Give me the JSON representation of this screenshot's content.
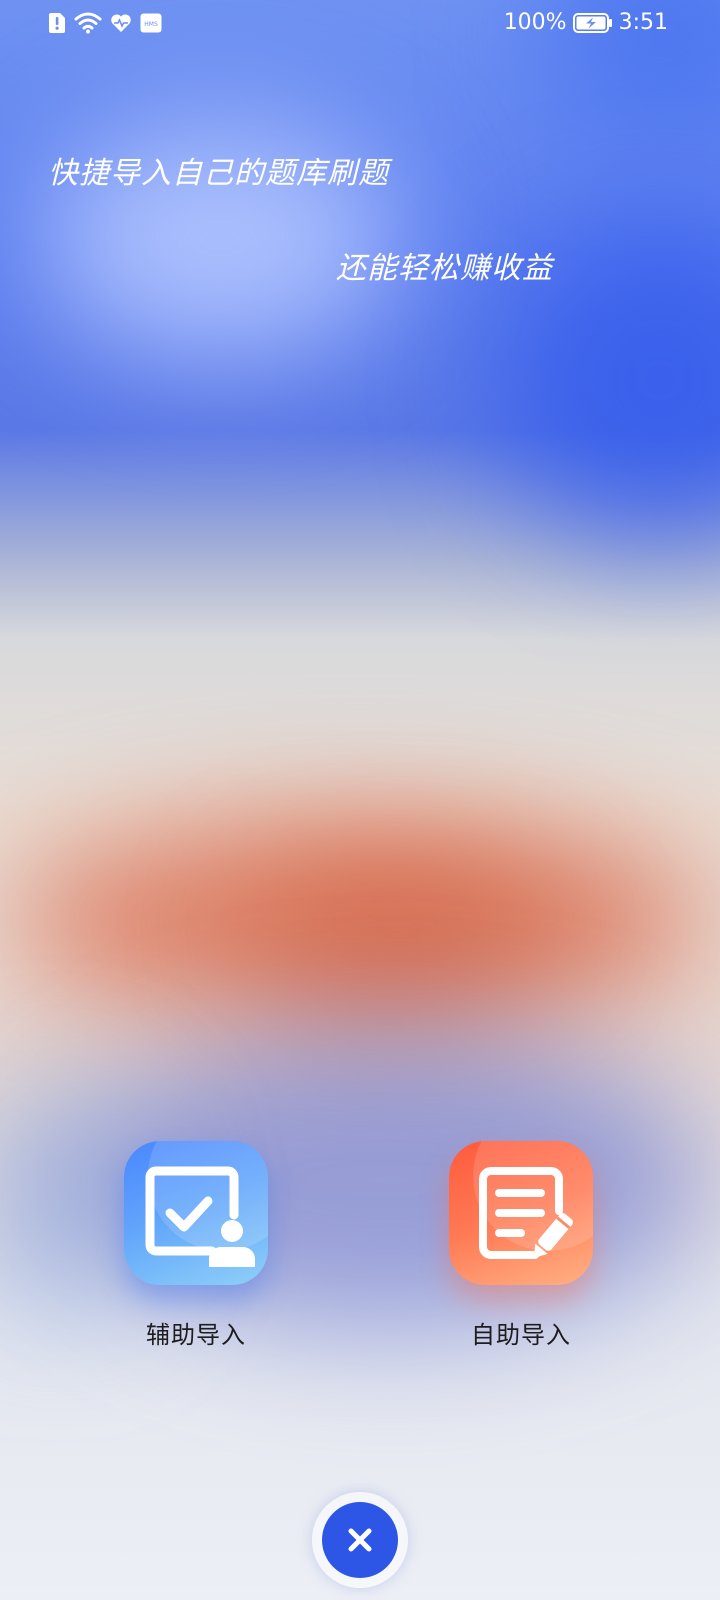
{
  "status_bar": {
    "battery_percent": "100%",
    "time": "3:51",
    "icons": [
      "alert-sim-icon",
      "wifi-icon",
      "heart-icon",
      "hms-icon",
      "battery-charging-icon"
    ],
    "hms_label": "HMS"
  },
  "slogan": {
    "line1": "快捷导入自己的题库刷题",
    "line2": "还能轻松赚收益"
  },
  "options": [
    {
      "label": "辅助导入",
      "icon": "assisted-import-icon",
      "color": "#4a87ff"
    },
    {
      "label": "自助导入",
      "icon": "self-import-icon",
      "color": "#ff5a3c"
    }
  ],
  "close": {
    "icon": "close-icon",
    "color": "#2e56e6"
  }
}
